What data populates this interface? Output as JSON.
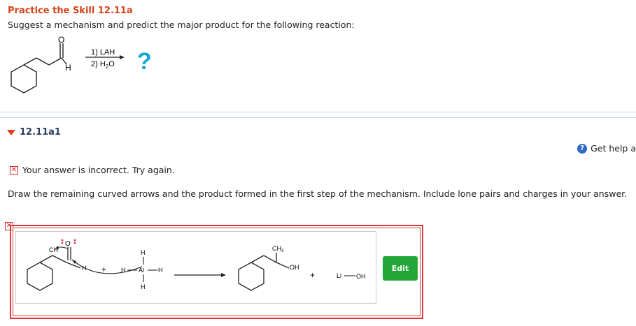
{
  "problem": {
    "title": "Practice the Skill 12.11a",
    "prompt": "Suggest a mechanism and predict the major product for the following reaction:",
    "reaction": {
      "reactant_O": "O",
      "reactant_H": "H",
      "step1": "1) LAH",
      "step2_prefix": "2) H",
      "step2_sub": "2",
      "step2_suffix": "O",
      "unknown": "?"
    }
  },
  "part": {
    "label": "12.11a1"
  },
  "help": {
    "label": "Get help a"
  },
  "feedback": {
    "message": "Your answer is incorrect.  Try again."
  },
  "instructions": "Draw the remaining curved arrows and the product formed in the first step of the mechanism. Include lone pairs and charges in your answer.",
  "mechanism": {
    "left_O": "O",
    "left_CH": "CH",
    "left_H": "H",
    "plus": "+",
    "al_top_H": "H",
    "al_left_H": "H",
    "al": "Al",
    "al_right_H": "H",
    "al_bottom_H": "H",
    "product_CH3": "CH",
    "product_CH3_sub": "3",
    "product_OH": "OH",
    "plus2": "+",
    "li": "Li",
    "li_OH": "OH"
  },
  "edit": {
    "label": "Edit"
  },
  "colors": {
    "title": "#d5431a",
    "error_red": "#d93a3a",
    "edit_green": "#23a638",
    "help_blue": "#2f69c8",
    "question_cyan": "#1aa7d6"
  }
}
